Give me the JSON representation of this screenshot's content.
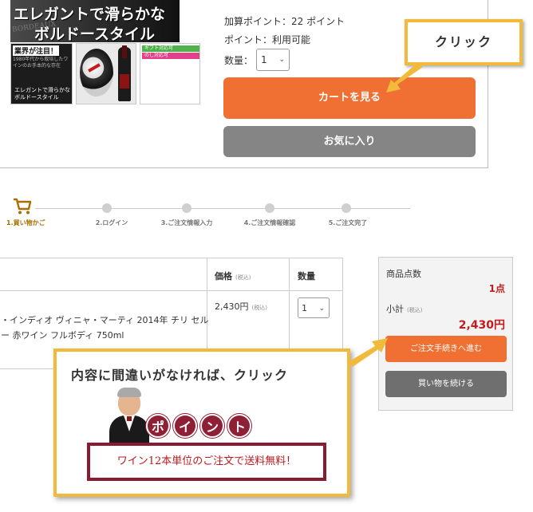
{
  "product": {
    "banner_line1": "エレガントで滑らかな",
    "banner_line2": "ボルドースタイル",
    "thumb1_head": "業界が注目！",
    "thumb1_body": "1980年代から栽培したワインのお手本的な存在",
    "thumb1_foot": "エレガントで滑らかなボルドースタイル",
    "tag_gift": "ギフト対応可",
    "tag_noshi": "のし対応可",
    "points_added": "加算ポイント：22 ポイント",
    "points_usable": "ポイント：利用可能",
    "qty_label": "数量：",
    "qty_value": "1",
    "cart_button": "カートを見る",
    "favorite_button": "お気に入り"
  },
  "callout_top": {
    "text": "クリック"
  },
  "steps": [
    {
      "label": "1.買い物かご"
    },
    {
      "label": "2.ログイン"
    },
    {
      "label": "3.ご注文情報入力"
    },
    {
      "label": "4.ご注文情報確認"
    },
    {
      "label": "5.ご注文完了"
    }
  ],
  "cart": {
    "header_price": "価格",
    "header_qty": "数量",
    "tax_note": "(税込)",
    "item_price": "2,430円",
    "item_name": "・インディオ ヴィニャ・マーティ 2014年 チリ セルー 赤ワイン フルボディ 750ml",
    "item_qty": "1"
  },
  "summary": {
    "count_label": "商品点数",
    "count_value": "1点",
    "subtotal_label": "小計",
    "subtotal_value": "2,430円",
    "checkout_button": "ご注文手続きへ進む",
    "continue_button": "買い物を続ける"
  },
  "callout_main": {
    "headline": "内容に間違いがなければ、クリック",
    "point_chars": [
      "ポ",
      "イ",
      "ン",
      "ト"
    ],
    "promo": "ワイン12本単位のご注文で送料無料！"
  },
  "colors": {
    "accent_orange": "#ef7032",
    "button_gray": "#858585",
    "callout_border": "#f2ba3a",
    "price_red": "#c21c1c",
    "point_maroon": "#8f1f35"
  }
}
